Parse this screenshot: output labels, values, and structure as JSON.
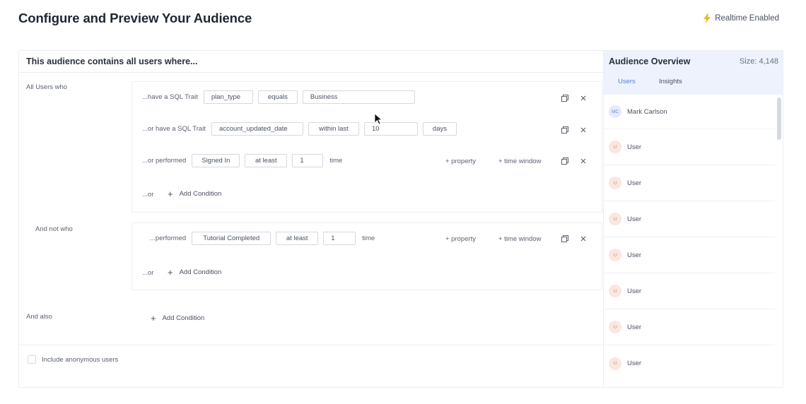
{
  "page": {
    "title": "Configure and Preview Your Audience",
    "realtime_label": "Realtime Enabled",
    "realtime_icon": "lightning-bolt-icon",
    "accent_color": "#f0b429"
  },
  "builder": {
    "heading": "This audience contains all users where...",
    "all_users_label": "All Users who",
    "and_not_label": "And not who",
    "and_also_label": "And also",
    "include_group": {
      "rows": [
        {
          "prefix": "...have a SQL Trait",
          "chips": [
            "plan_type",
            "equals",
            "Business"
          ]
        },
        {
          "prefix": "...or have a SQL Trait",
          "chips": [
            "account_updated_date",
            "within last",
            "10",
            "days"
          ]
        },
        {
          "prefix": "...or performed",
          "chips": [
            "Signed In",
            "at least",
            "1"
          ],
          "suffix": "time",
          "property_link": "+ property",
          "time_window_link": "+ time window"
        }
      ],
      "or_label": "...or",
      "add_condition": "Add Condition"
    },
    "exclude_group": {
      "rows": [
        {
          "prefix": "...performed",
          "chips": [
            "Tutorial Completed",
            "at least",
            "1"
          ],
          "suffix": "time",
          "property_link": "+ property",
          "time_window_link": "+ time window"
        }
      ],
      "or_label": "...or",
      "add_condition": "Add Condition"
    },
    "also_group": {
      "add_condition": "Add Condition"
    },
    "include_anonymous": "Include anonymous users"
  },
  "overview": {
    "title": "Audience Overview",
    "size": "Size: 4,148",
    "tabs": [
      "Users",
      "Insights"
    ],
    "active_tab": "Users",
    "users": [
      {
        "initials": "MC",
        "name": "Mark Carlson"
      },
      {
        "initials": "U",
        "name": "User"
      },
      {
        "initials": "U",
        "name": "User"
      },
      {
        "initials": "U",
        "name": "User"
      },
      {
        "initials": "U",
        "name": "User"
      },
      {
        "initials": "U",
        "name": "User"
      },
      {
        "initials": "U",
        "name": "User"
      },
      {
        "initials": "U",
        "name": "User"
      }
    ]
  }
}
